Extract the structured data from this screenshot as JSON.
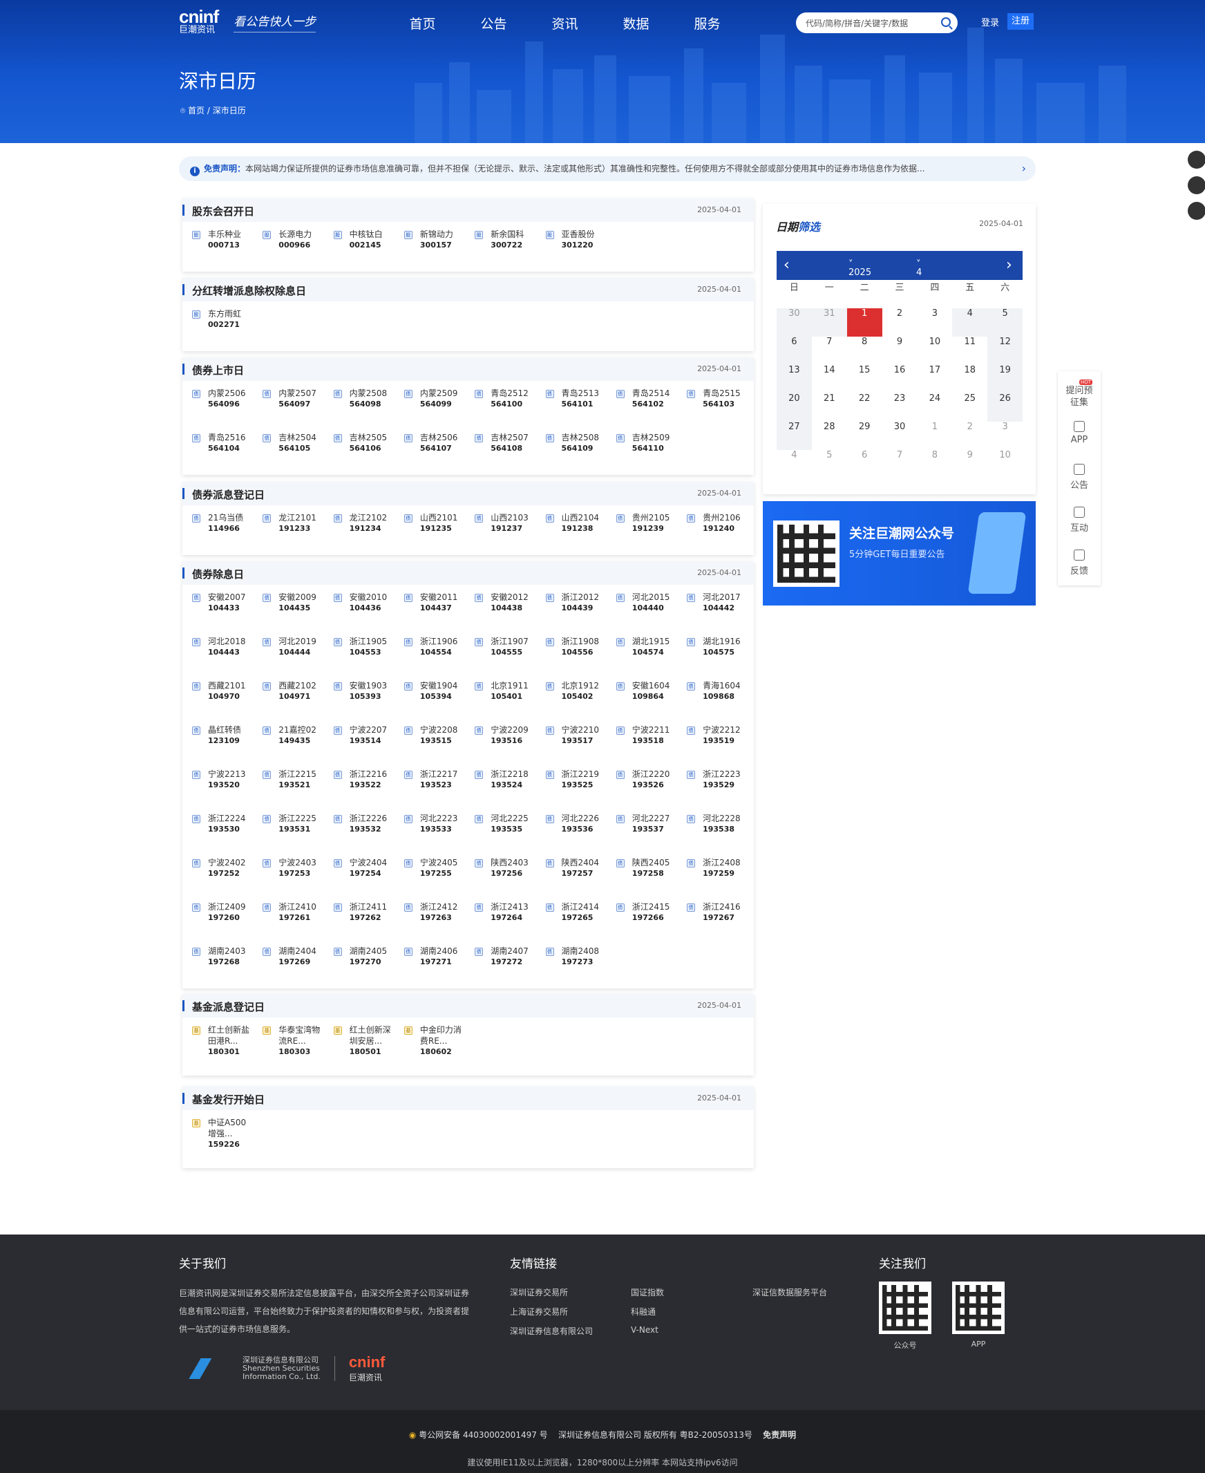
{
  "header": {
    "brand": "cninf",
    "brand_sub": "巨潮资讯",
    "slogan": "看公告快人一步",
    "nav": [
      "首页",
      "公告",
      "资讯",
      "数据",
      "服务"
    ],
    "search_placeholder": "代码/简称/拼音/关键字/数据",
    "login": "登录",
    "register": "注册",
    "page_title": "深市日历",
    "breadcrumb_home": "首页",
    "breadcrumb_sep": "/",
    "breadcrumb_current": "深市日历"
  },
  "disclaimer": {
    "label": "免责声明：",
    "text": "本网站竭力保证所提供的证券市场信息准确可靠，但并不担保（无论提示、默示、法定或其他形式）其准确性和完整性。任何使用方不得就全部或部分使用其中的证券市场信息作为依据..."
  },
  "sections": [
    {
      "title": "股东会召开日",
      "date": "2025-04-01",
      "tag": "股",
      "type": "stock",
      "items": [
        [
          "丰乐种业",
          "000713"
        ],
        [
          "长源电力",
          "000966"
        ],
        [
          "中核钛白",
          "002145"
        ],
        [
          "新锦动力",
          "300157"
        ],
        [
          "新余国科",
          "300722"
        ],
        [
          "亚香股份",
          "301220"
        ]
      ]
    },
    {
      "title": "分红转增派息除权除息日",
      "date": "2025-04-01",
      "tag": "股",
      "type": "stock",
      "items": [
        [
          "东方雨虹",
          "002271"
        ]
      ]
    },
    {
      "title": "债券上市日",
      "date": "2025-04-01",
      "tag": "债",
      "type": "bond",
      "items": [
        [
          "内蒙2506",
          "564096"
        ],
        [
          "内蒙2507",
          "564097"
        ],
        [
          "内蒙2508",
          "564098"
        ],
        [
          "内蒙2509",
          "564099"
        ],
        [
          "青岛2512",
          "564100"
        ],
        [
          "青岛2513",
          "564101"
        ],
        [
          "青岛2514",
          "564102"
        ],
        [
          "青岛2515",
          "564103"
        ],
        [
          "青岛2516",
          "564104"
        ],
        [
          "吉林2504",
          "564105"
        ],
        [
          "吉林2505",
          "564106"
        ],
        [
          "吉林2506",
          "564107"
        ],
        [
          "吉林2507",
          "564108"
        ],
        [
          "吉林2508",
          "564109"
        ],
        [
          "吉林2509",
          "564110"
        ]
      ]
    },
    {
      "title": "债券派息登记日",
      "date": "2025-04-01",
      "tag": "债",
      "type": "bond",
      "items": [
        [
          "21乌当债",
          "114966"
        ],
        [
          "龙江2101",
          "191233"
        ],
        [
          "龙江2102",
          "191234"
        ],
        [
          "山西2101",
          "191235"
        ],
        [
          "山西2103",
          "191237"
        ],
        [
          "山西2104",
          "191238"
        ],
        [
          "贵州2105",
          "191239"
        ],
        [
          "贵州2106",
          "191240"
        ]
      ]
    },
    {
      "title": "债券除息日",
      "date": "2025-04-01",
      "tag": "债",
      "type": "bond",
      "items": [
        [
          "安徽2007",
          "104433"
        ],
        [
          "安徽2009",
          "104435"
        ],
        [
          "安徽2010",
          "104436"
        ],
        [
          "安徽2011",
          "104437"
        ],
        [
          "安徽2012",
          "104438"
        ],
        [
          "浙江2012",
          "104439"
        ],
        [
          "河北2015",
          "104440"
        ],
        [
          "河北2017",
          "104442"
        ],
        [
          "河北2018",
          "104443"
        ],
        [
          "河北2019",
          "104444"
        ],
        [
          "浙江1905",
          "104553"
        ],
        [
          "浙江1906",
          "104554"
        ],
        [
          "浙江1907",
          "104555"
        ],
        [
          "浙江1908",
          "104556"
        ],
        [
          "湖北1915",
          "104574"
        ],
        [
          "湖北1916",
          "104575"
        ],
        [
          "西藏2101",
          "104970"
        ],
        [
          "西藏2102",
          "104971"
        ],
        [
          "安徽1903",
          "105393"
        ],
        [
          "安徽1904",
          "105394"
        ],
        [
          "北京1911",
          "105401"
        ],
        [
          "北京1912",
          "105402"
        ],
        [
          "安徽1604",
          "109864"
        ],
        [
          "青海1604",
          "109868"
        ],
        [
          "晶红转债",
          "123109"
        ],
        [
          "21嘉控02",
          "149435"
        ],
        [
          "宁波2207",
          "193514"
        ],
        [
          "宁波2208",
          "193515"
        ],
        [
          "宁波2209",
          "193516"
        ],
        [
          "宁波2210",
          "193517"
        ],
        [
          "宁波2211",
          "193518"
        ],
        [
          "宁波2212",
          "193519"
        ],
        [
          "宁波2213",
          "193520"
        ],
        [
          "浙江2215",
          "193521"
        ],
        [
          "浙江2216",
          "193522"
        ],
        [
          "浙江2217",
          "193523"
        ],
        [
          "浙江2218",
          "193524"
        ],
        [
          "浙江2219",
          "193525"
        ],
        [
          "浙江2220",
          "193526"
        ],
        [
          "浙江2223",
          "193529"
        ],
        [
          "浙江2224",
          "193530"
        ],
        [
          "浙江2225",
          "193531"
        ],
        [
          "浙江2226",
          "193532"
        ],
        [
          "河北2223",
          "193533"
        ],
        [
          "河北2225",
          "193535"
        ],
        [
          "河北2226",
          "193536"
        ],
        [
          "河北2227",
          "193537"
        ],
        [
          "河北2228",
          "193538"
        ],
        [
          "宁波2402",
          "197252"
        ],
        [
          "宁波2403",
          "197253"
        ],
        [
          "宁波2404",
          "197254"
        ],
        [
          "宁波2405",
          "197255"
        ],
        [
          "陕西2403",
          "197256"
        ],
        [
          "陕西2404",
          "197257"
        ],
        [
          "陕西2405",
          "197258"
        ],
        [
          "浙江2408",
          "197259"
        ],
        [
          "浙江2409",
          "197260"
        ],
        [
          "浙江2410",
          "197261"
        ],
        [
          "浙江2411",
          "197262"
        ],
        [
          "浙江2412",
          "197263"
        ],
        [
          "浙江2413",
          "197264"
        ],
        [
          "浙江2414",
          "197265"
        ],
        [
          "浙江2415",
          "197266"
        ],
        [
          "浙江2416",
          "197267"
        ],
        [
          "湖南2403",
          "197268"
        ],
        [
          "湖南2404",
          "197269"
        ],
        [
          "湖南2405",
          "197270"
        ],
        [
          "湖南2406",
          "197271"
        ],
        [
          "湖南2407",
          "197272"
        ],
        [
          "湖南2408",
          "197273"
        ]
      ]
    },
    {
      "title": "基金派息登记日",
      "date": "2025-04-01",
      "tag": "基",
      "type": "fund",
      "items": [
        [
          "红土创新盐田港R...",
          "180301"
        ],
        [
          "华泰宝湾物流RE...",
          "180303"
        ],
        [
          "红土创新深圳安居...",
          "180501"
        ],
        [
          "中金印力消费RE...",
          "180602"
        ]
      ]
    },
    {
      "title": "基金发行开始日",
      "date": "2025-04-01",
      "tag": "基",
      "type": "fund",
      "items": [
        [
          "中证A500增强...",
          "159226"
        ]
      ]
    }
  ],
  "calendar": {
    "title_a": "日期",
    "title_b": "筛选",
    "date": "2025-04-01",
    "year": "2025年",
    "month": "4月",
    "prev": "‹",
    "next": "›",
    "weekdays": [
      "日",
      "一",
      "二",
      "三",
      "四",
      "五",
      "六"
    ],
    "weeks": [
      [
        "30",
        "31",
        "1",
        "2",
        "3",
        "4",
        "5"
      ],
      [
        "6",
        "7",
        "8",
        "9",
        "10",
        "11",
        "12"
      ],
      [
        "13",
        "14",
        "15",
        "16",
        "17",
        "18",
        "19"
      ],
      [
        "20",
        "21",
        "22",
        "23",
        "24",
        "25",
        "26"
      ],
      [
        "27",
        "28",
        "29",
        "30",
        "1",
        "2",
        "3"
      ],
      [
        "4",
        "5",
        "6",
        "7",
        "8",
        "9",
        "10"
      ]
    ],
    "selected": "1"
  },
  "banner": {
    "title": "关注巨潮网公众号",
    "subtitle": "5分钟GET每日重要公告"
  },
  "sidebar": {
    "hot": "HOT",
    "items": [
      "提问预征集",
      "APP",
      "公告",
      "互动",
      "反馈"
    ]
  },
  "footer": {
    "about_title": "关于我们",
    "about_text": "巨潮资讯网是深圳证券交易所法定信息披露平台，由深交所全资子公司深圳证券信息有限公司运营，平台始终致力于保护投资者的知情权和参与权，为投资者提供一站式的证券市场信息服务。",
    "links_title": "友情链接",
    "links": [
      "深圳证券交易所",
      "国证指数",
      "深证信数据服务平台",
      "上海证券交易所",
      "科融通",
      "深圳证券信息有限公司",
      "V-Next"
    ],
    "follow_title": "关注我们",
    "qr1": "公众号",
    "qr2": "APP",
    "ssi_cn": "深圳证券信息有限公司",
    "ssi_en1": "Shenzhen Securities",
    "ssi_en2": "Information Co., Ltd.",
    "brand": "cninf",
    "brand_sub": "巨潮资讯"
  },
  "bottom": {
    "police": "粤公网安备 44030002001497 号",
    "copyright": "深圳证券信息有限公司 版权所有 粤B2-20050313号",
    "disclaimer": "免责声明",
    "browser": "建议使用IE11及以上浏览器，1280*800以上分辨率 本网站支持ipv6访问"
  },
  "colors": {
    "primary": "#1a56c4",
    "selected_day": "#dc2f2f",
    "footer_bg": "#2b2c31"
  }
}
